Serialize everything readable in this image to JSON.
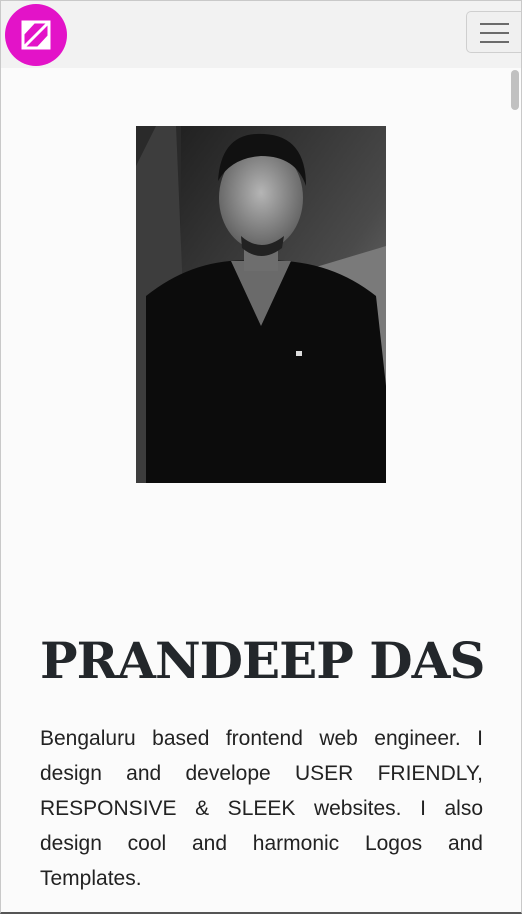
{
  "navbar": {
    "logo_icon": "brand-logo-icon",
    "menu_icon": "hamburger-menu-icon",
    "brand_color": "#e313c8"
  },
  "profile": {
    "photo_description_icon": "profile-photo",
    "name": "PRANDEEP DAS",
    "bio": "Bengaluru based frontend web engineer. I design and develope USER FRIENDLY, RESPONSIVE & SLEEK websites. I also design cool and harmonic Logos and Templates."
  }
}
